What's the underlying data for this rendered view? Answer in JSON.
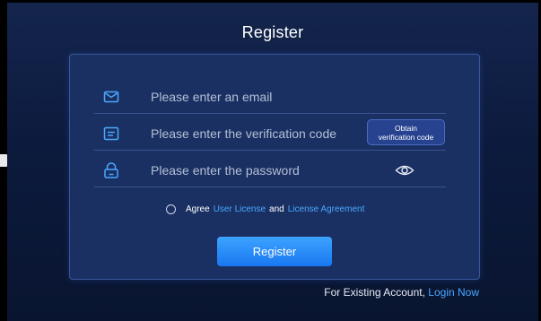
{
  "title": "Register",
  "form": {
    "email_placeholder": "Please enter an email",
    "code_placeholder": "Please enter the verification code",
    "password_placeholder": "Please enter the password",
    "obtain_line1": "Obtain",
    "obtain_line2": "verification code"
  },
  "agreement": {
    "agree": "Agree",
    "user_license": "User License",
    "and": "and",
    "license_agreement": "License Agreement",
    "checked": false
  },
  "register_label": "Register",
  "footer": {
    "prompt": "For Existing Account,",
    "login_link": "Login Now"
  },
  "colors": {
    "accent": "#1e88ff",
    "link": "#4aa7ff",
    "card_bg": "#1a3062"
  },
  "icons": {
    "email": "envelope-icon",
    "code": "message-icon",
    "password": "lock-icon",
    "visibility": "eye-icon",
    "agree": "radio-icon"
  }
}
